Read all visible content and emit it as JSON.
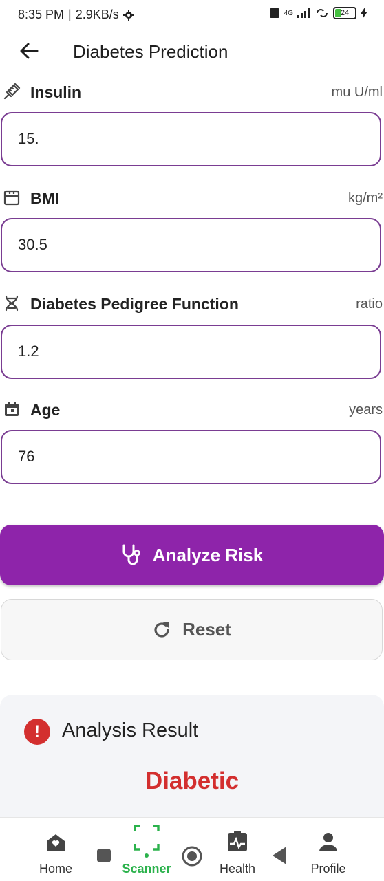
{
  "status_bar": {
    "time": "8:35 PM",
    "separator": "|",
    "speed": "2.9KB/s",
    "network": "4G",
    "battery": "24"
  },
  "app_bar": {
    "title": "Diabetes Prediction"
  },
  "fields": [
    {
      "label": "Insulin",
      "unit": "mu U/ml",
      "value": "15.",
      "icon": "syringe-icon"
    },
    {
      "label": "BMI",
      "unit": "kg/m²",
      "value": "30.5",
      "icon": "scale-icon"
    },
    {
      "label": "Diabetes Pedigree Function",
      "unit": "ratio",
      "value": "1.2",
      "icon": "dna-icon"
    },
    {
      "label": "Age",
      "unit": "years",
      "value": "76",
      "icon": "calendar-icon"
    }
  ],
  "buttons": {
    "analyze": "Analyze Risk",
    "reset": "Reset"
  },
  "result": {
    "title": "Analysis Result",
    "value": "Diabetic",
    "alert_glyph": "!"
  },
  "bottom_nav": {
    "items": [
      {
        "label": "Home",
        "icon": "home-icon"
      },
      {
        "label": "Scanner",
        "icon": "scanner-icon"
      },
      {
        "label": "Health",
        "icon": "health-icon"
      },
      {
        "label": "Profile",
        "icon": "profile-icon"
      }
    ],
    "active": "Scanner"
  },
  "colors": {
    "accent": "#8e24aa",
    "border": "#7a3d92",
    "danger": "#d32f2f",
    "active_nav": "#2bb24c"
  }
}
